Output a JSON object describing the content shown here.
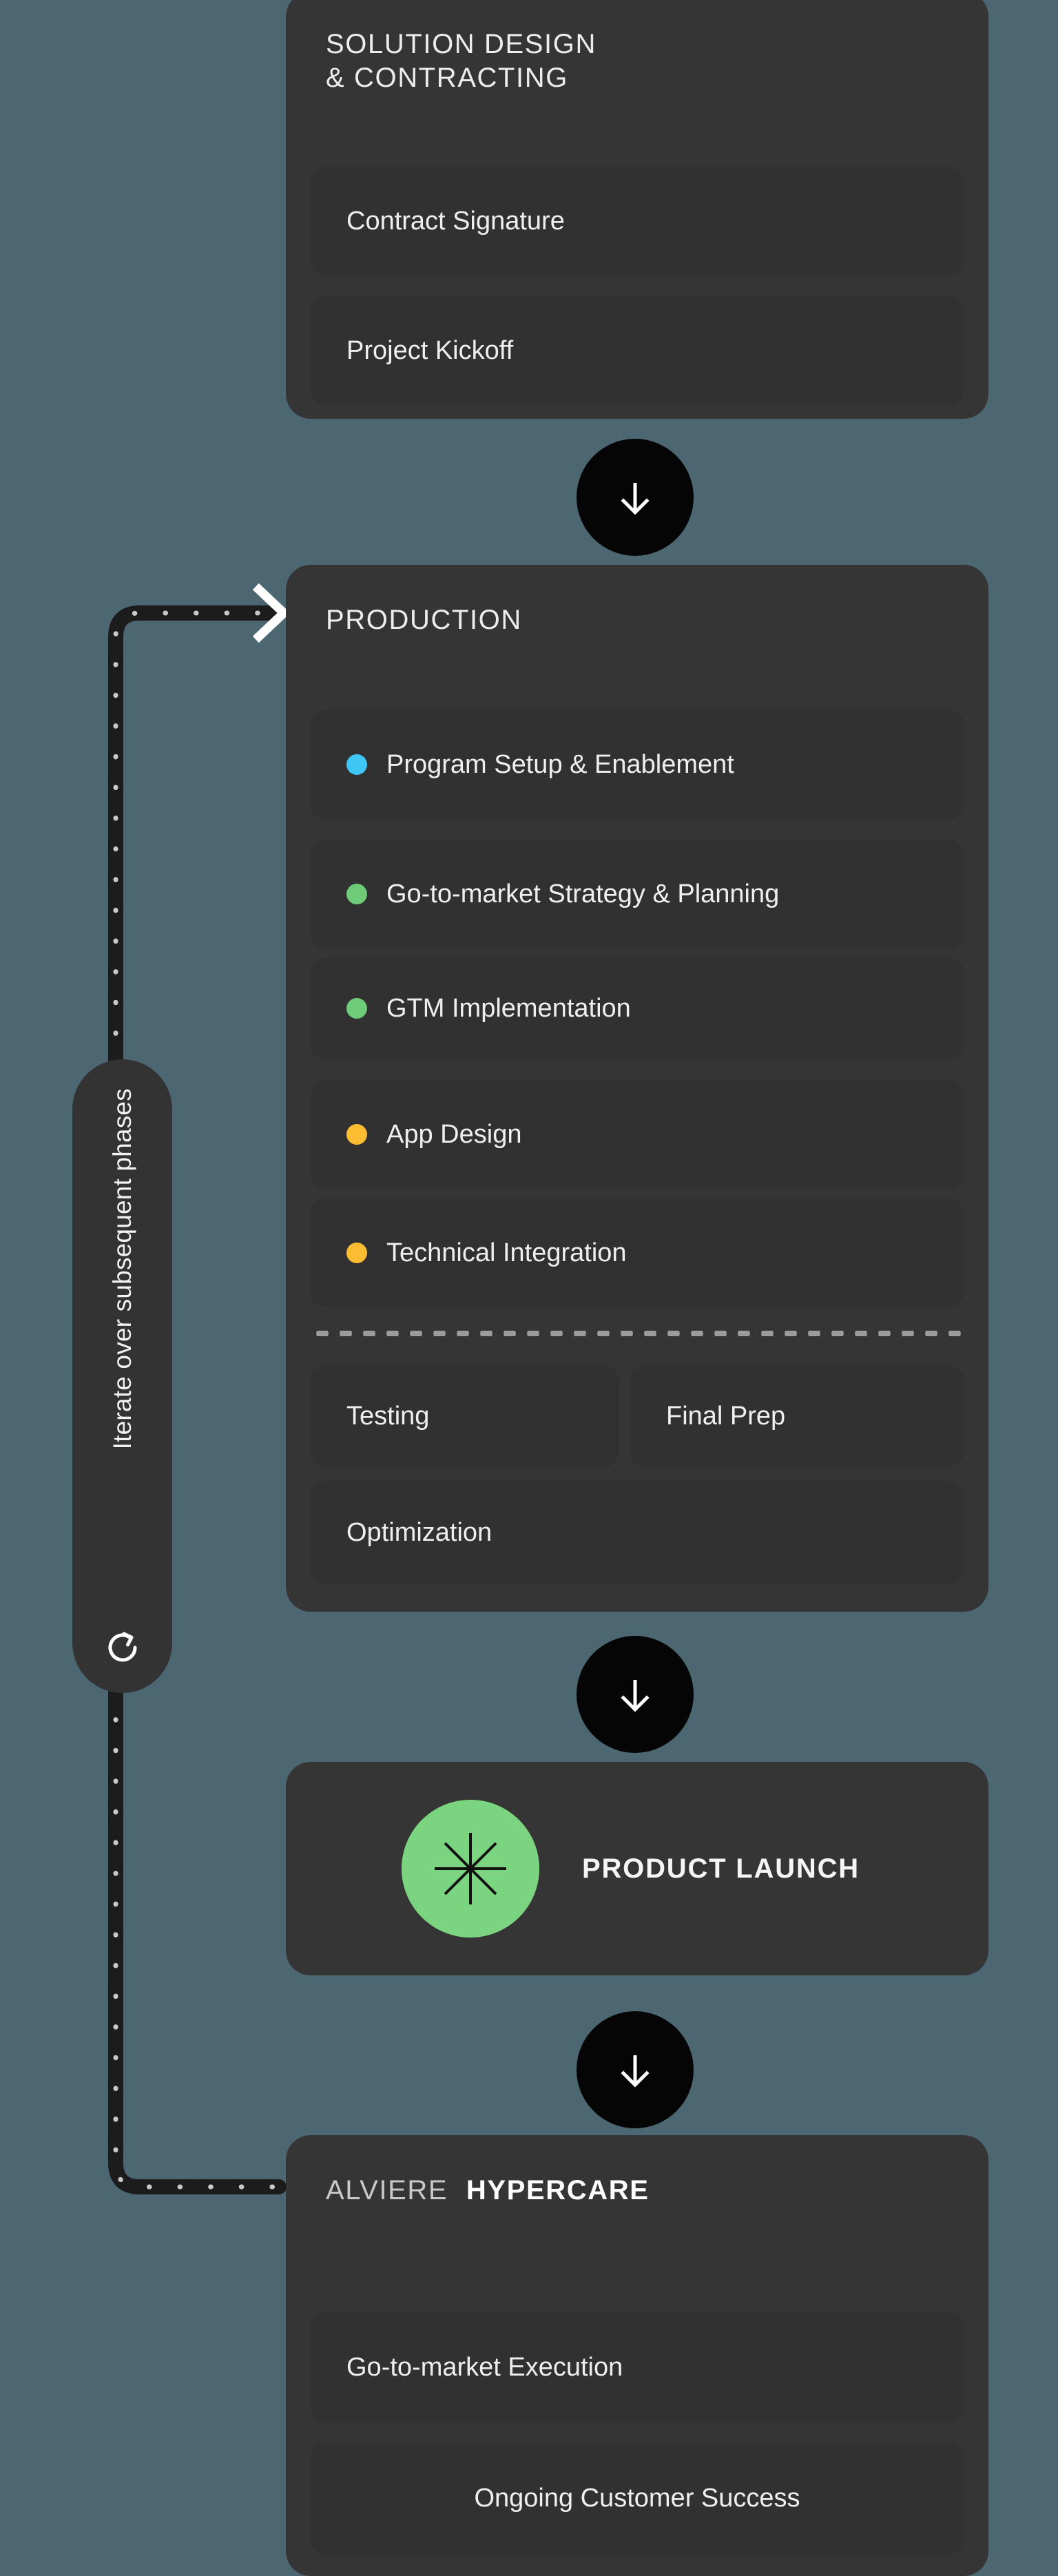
{
  "theme": {
    "background": "#4C6771",
    "card_bg": "#353535",
    "row_bg": "#313131",
    "badge_bg": "#050505",
    "text": "#EFEFEF",
    "dot_blue": "#3EC6F5",
    "dot_green": "#6ECB77",
    "dot_orange": "#FDBD32",
    "launch_green": "#7BD480"
  },
  "phases": {
    "solution_design": {
      "title_line1": "SOLUTION DESIGN",
      "title_line2": "& CONTRACTING",
      "items": [
        {
          "label": "Contract Signature"
        },
        {
          "label": "Project Kickoff"
        }
      ]
    },
    "production": {
      "title": "PRODUCTION",
      "workstreams": [
        {
          "label": "Program Setup & Enablement",
          "dot_color": "#3EC6F5"
        },
        {
          "label": "Go-to-market Strategy & Planning",
          "dot_color": "#6ECB77"
        },
        {
          "label": "GTM Implementation",
          "dot_color": "#6ECB77"
        },
        {
          "label": "App Design",
          "dot_color": "#FDBD32"
        },
        {
          "label": "Technical Integration",
          "dot_color": "#FDBD32"
        }
      ],
      "readiness": [
        {
          "label": "Testing"
        },
        {
          "label": "Final Prep"
        },
        {
          "label": "Optimization"
        }
      ]
    },
    "product_launch": {
      "label": "PRODUCT LAUNCH",
      "icon": "asterisk-starburst-icon"
    },
    "hypercare": {
      "title_brand": "ALVIERE",
      "title_strong": "HYPERCARE",
      "items": [
        {
          "label": "Go-to-market Execution"
        },
        {
          "label": "Ongoing Customer Success"
        }
      ]
    }
  },
  "loop": {
    "label": "Iterate over subsequent phases",
    "icon": "refresh-loop-icon"
  },
  "connectors": {
    "arrow_1": "arrow-down-icon",
    "arrow_2": "arrow-down-icon",
    "arrow_3": "arrow-down-icon",
    "loop_arrow": "chevron-right-icon"
  }
}
